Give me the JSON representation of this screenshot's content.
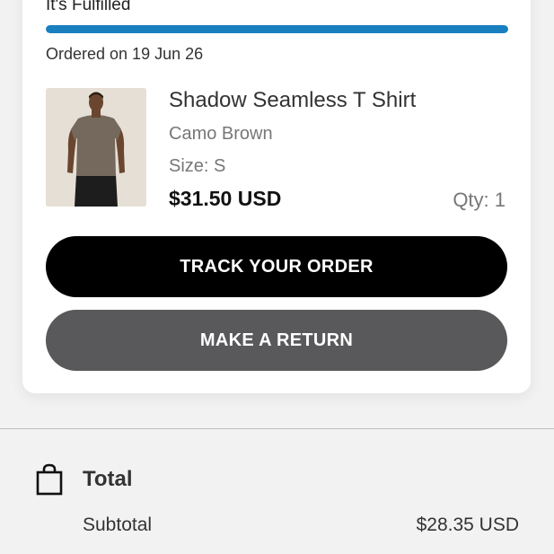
{
  "order": {
    "status": "It's Fulfilled",
    "progress_percent": 100,
    "ordered_on": "Ordered on 19 Jun 26",
    "accent_color": "#1a7fbf"
  },
  "product": {
    "name": "Shadow Seamless T Shirt",
    "color": "Camo Brown",
    "size": "Size: S",
    "price": "$31.50 USD",
    "qty": "Qty: 1",
    "image_icon": "product-photo"
  },
  "actions": {
    "track_label": "TRACK YOUR ORDER",
    "return_label": "MAKE A RETURN"
  },
  "summary": {
    "icon": "shopping-bag-icon",
    "heading": "Total",
    "subtotal_label": "Subtotal",
    "subtotal_value": "$28.35 USD"
  }
}
